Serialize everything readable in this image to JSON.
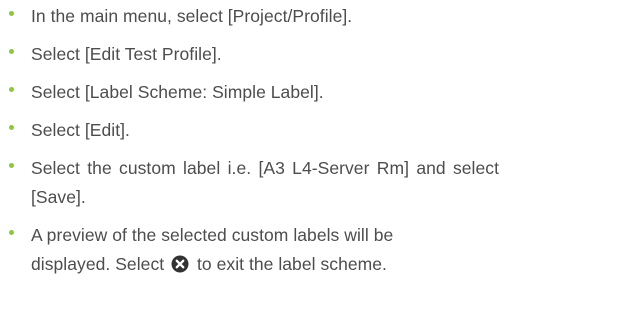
{
  "steps": [
    {
      "text": "In the main menu, select [Project/Profile]."
    },
    {
      "text": "Select [Edit Test Profile]."
    },
    {
      "text": "Select [Label Scheme: Simple Label]."
    },
    {
      "text": "Select [Edit]."
    },
    {
      "line1": "Select the custom label i.e. [A3 L4-Server Rm] and select",
      "line2": "[Save]."
    },
    {
      "line1": "A preview of the selected custom labels will be",
      "line2_before": "displayed. Select",
      "icon": "close-circle-icon",
      "line2_after": "to exit the label scheme."
    }
  ],
  "colors": {
    "bullet": "#8dc63f",
    "text": "#4d4d4d",
    "icon_fill": "#333333"
  }
}
